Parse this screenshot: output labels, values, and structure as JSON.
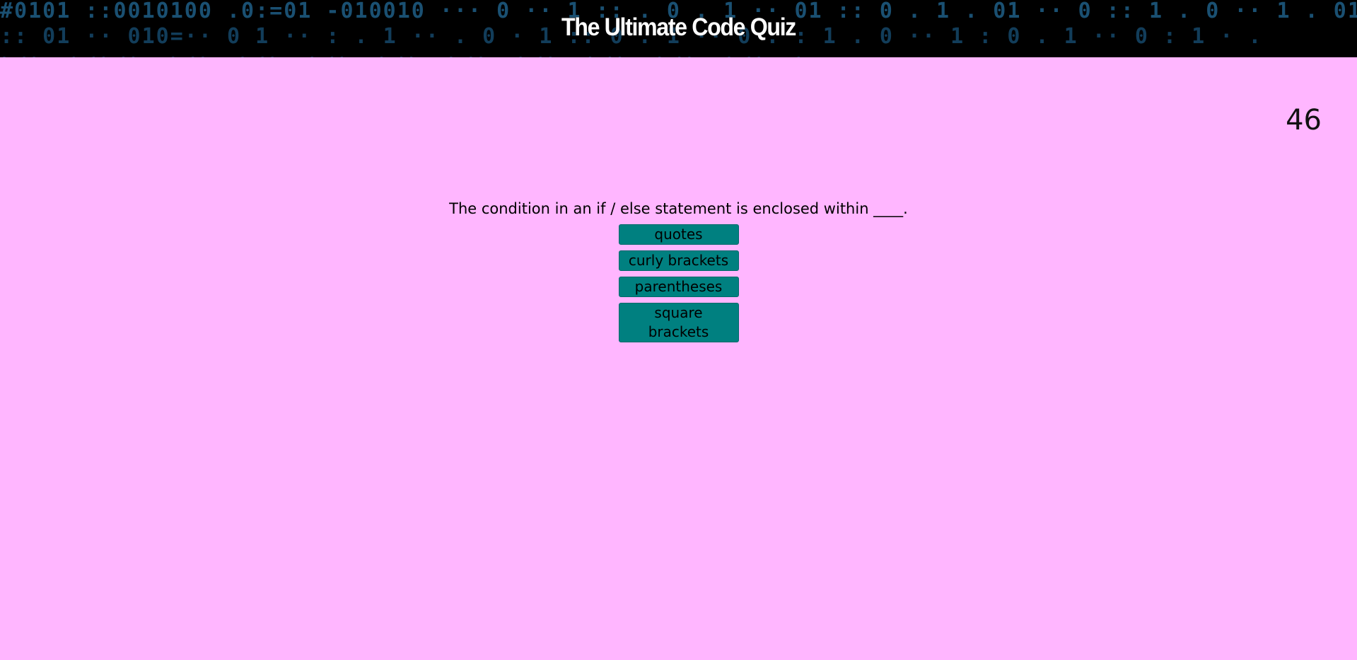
{
  "header": {
    "title": "The Ultimate Code Quiz"
  },
  "timer": {
    "value": "46"
  },
  "quiz": {
    "question": "The condition in an if / else statement is enclosed within ____.",
    "choices": [
      "quotes",
      "curly brackets",
      "parentheses",
      "square brackets"
    ]
  },
  "colors": {
    "background": "#ffb6ff",
    "header_background": "#000000",
    "button": "#008080",
    "title_text": "#ffffff"
  }
}
